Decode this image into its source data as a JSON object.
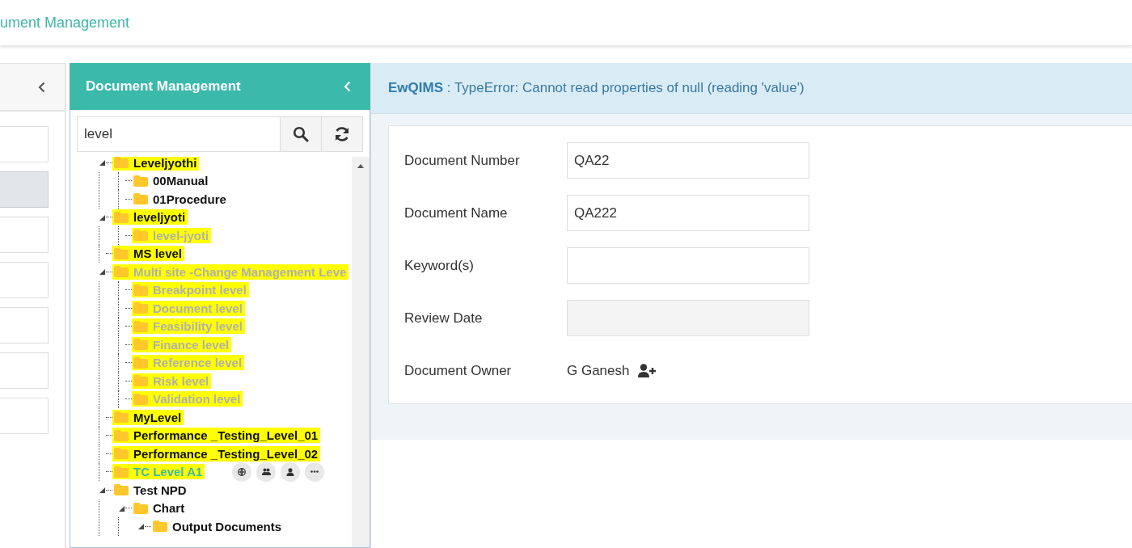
{
  "header": {
    "title": "ument Management"
  },
  "left_panel": {
    "items": [
      {
        "selected": false
      },
      {
        "selected": true
      },
      {
        "selected": false
      },
      {
        "selected": false
      },
      {
        "selected": false
      },
      {
        "selected": false
      },
      {
        "selected": false
      }
    ]
  },
  "tree_panel": {
    "title": "Document Management",
    "search": {
      "value": "level"
    },
    "tree": [
      {
        "label": "Leveljyothi",
        "expanded": true,
        "highlighted": true,
        "disabled": false,
        "selected": false,
        "children": [
          {
            "label": "00Manual",
            "highlighted": false,
            "disabled": false,
            "selected": false
          },
          {
            "label": "01Procedure",
            "highlighted": false,
            "disabled": false,
            "selected": false
          }
        ]
      },
      {
        "label": "leveljyoti",
        "expanded": true,
        "highlighted": true,
        "disabled": false,
        "selected": false,
        "children": [
          {
            "label": "level-jyoti",
            "highlighted": true,
            "disabled": true,
            "selected": false
          }
        ]
      },
      {
        "label": "MS level",
        "highlighted": true,
        "disabled": false,
        "selected": false
      },
      {
        "label": "Multi site -Change Management Leve",
        "expanded": true,
        "highlighted": true,
        "disabled": true,
        "selected": false,
        "children": [
          {
            "label": "Breakpoint level",
            "highlighted": true,
            "disabled": true,
            "selected": false
          },
          {
            "label": "Document level",
            "highlighted": true,
            "disabled": true,
            "selected": false
          },
          {
            "label": "Feasibility level",
            "highlighted": true,
            "disabled": true,
            "selected": false
          },
          {
            "label": "Finance level",
            "highlighted": true,
            "disabled": true,
            "selected": false
          },
          {
            "label": "Reference level",
            "highlighted": true,
            "disabled": true,
            "selected": false
          },
          {
            "label": "Risk level",
            "highlighted": true,
            "disabled": true,
            "selected": false
          },
          {
            "label": "Validation level",
            "highlighted": true,
            "disabled": true,
            "selected": false
          }
        ]
      },
      {
        "label": "MyLevel",
        "highlighted": true,
        "disabled": false,
        "selected": false
      },
      {
        "label": "Performance _Testing_Level_01",
        "highlighted": true,
        "disabled": false,
        "selected": false
      },
      {
        "label": "Performance _Testing_Level_02",
        "highlighted": true,
        "disabled": false,
        "selected": false
      },
      {
        "label": "TC Level A1",
        "highlighted": true,
        "disabled": false,
        "selected": true
      },
      {
        "label": "Test NPD",
        "expanded": true,
        "highlighted": false,
        "disabled": false,
        "selected": false,
        "children": [
          {
            "label": "Chart",
            "expanded": true,
            "highlighted": false,
            "disabled": false,
            "selected": false,
            "children": [
              {
                "label": "Output Documents",
                "expanded": true,
                "highlighted": false,
                "disabled": false,
                "selected": false
              }
            ]
          }
        ]
      }
    ]
  },
  "message": {
    "source": "EwQIMS",
    "text": " : TypeError: Cannot read properties of null (reading 'value')"
  },
  "form": {
    "fields": [
      {
        "kind": "input",
        "label": "Document Number",
        "value": "QA22"
      },
      {
        "kind": "input",
        "label": "Document Name",
        "value": "QA222"
      },
      {
        "kind": "input",
        "label": "Keyword(s)"
      },
      {
        "kind": "readonly",
        "label": "Review Date"
      },
      {
        "kind": "owner",
        "label": "Document Owner",
        "value": "G Ganesh"
      }
    ]
  }
}
